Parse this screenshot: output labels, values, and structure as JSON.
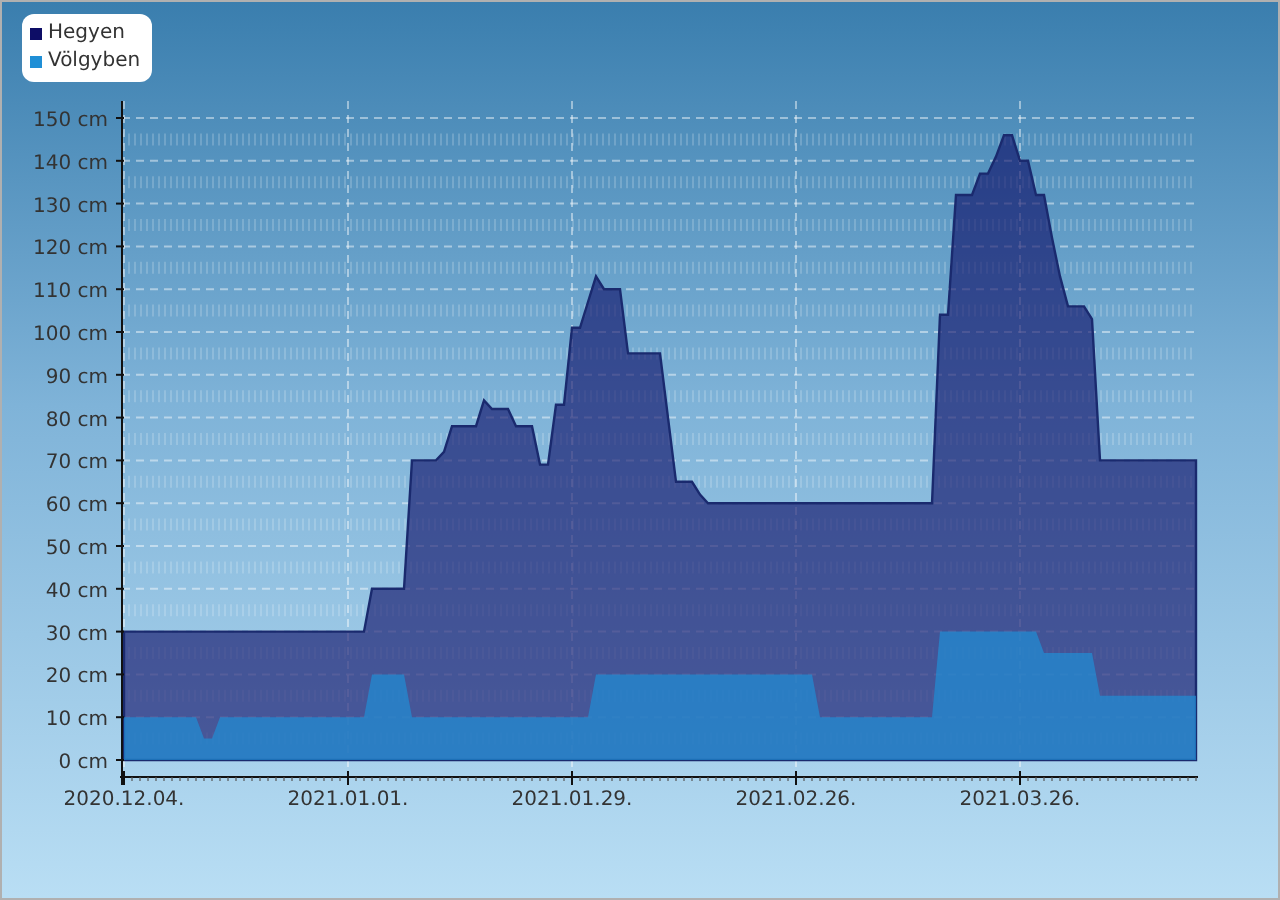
{
  "chart": {
    "chart_data": {
      "type": "area",
      "stacked": false,
      "grid": true,
      "legend": "top-left",
      "categories": [
        "2020.12.04.",
        null,
        null,
        null,
        null,
        null,
        null,
        null,
        null,
        null,
        null,
        null,
        null,
        null,
        null,
        null,
        null,
        null,
        null,
        null,
        null,
        null,
        null,
        null,
        null,
        null,
        null,
        null,
        "2021.01.01.",
        null,
        null,
        null,
        null,
        null,
        null,
        null,
        null,
        null,
        null,
        null,
        null,
        null,
        null,
        null,
        null,
        null,
        null,
        null,
        null,
        null,
        null,
        null,
        null,
        null,
        null,
        null,
        "2021.01.29.",
        null,
        null,
        null,
        null,
        null,
        null,
        null,
        null,
        null,
        null,
        null,
        null,
        null,
        null,
        null,
        null,
        null,
        null,
        null,
        null,
        null,
        null,
        null,
        null,
        null,
        null,
        null,
        "2021.02.26.",
        null,
        null,
        null,
        null,
        null,
        null,
        null,
        null,
        null,
        null,
        null,
        null,
        null,
        null,
        null,
        null,
        null,
        null,
        null,
        null,
        null,
        null,
        null,
        null,
        null,
        null,
        null,
        "2021.03.26.",
        null,
        null,
        null,
        null,
        null,
        null,
        null,
        null,
        null,
        null,
        null,
        null,
        null,
        null,
        null,
        null,
        null,
        null,
        null,
        null,
        null,
        null
      ],
      "series": [
        {
          "name": "Hegyen",
          "color": "#0d0d66",
          "values": [
            30,
            30,
            30,
            30,
            30,
            30,
            30,
            30,
            30,
            30,
            30,
            30,
            30,
            30,
            30,
            30,
            30,
            30,
            30,
            30,
            30,
            30,
            30,
            30,
            30,
            30,
            30,
            30,
            30,
            30,
            30,
            40,
            40,
            40,
            40,
            40,
            70,
            70,
            70,
            70,
            72,
            78,
            78,
            78,
            78,
            84,
            82,
            82,
            82,
            78,
            78,
            78,
            69,
            69,
            83,
            83,
            101,
            101,
            107,
            113,
            110,
            110,
            110,
            95,
            95,
            95,
            95,
            95,
            80,
            65,
            65,
            65,
            62,
            60,
            60,
            60,
            60,
            60,
            60,
            60,
            60,
            60,
            60,
            60,
            60,
            60,
            60,
            60,
            60,
            60,
            60,
            60,
            60,
            60,
            60,
            60,
            60,
            60,
            60,
            60,
            60,
            60,
            104,
            104,
            132,
            132,
            132,
            137,
            137,
            141,
            146,
            146,
            140,
            140,
            132,
            132,
            122,
            113,
            106,
            106,
            106,
            103,
            70,
            70,
            70,
            70,
            70,
            70,
            70,
            70,
            70,
            70,
            70,
            70,
            70
          ]
        },
        {
          "name": "Völgyben",
          "color": "#1f8fd6",
          "values": [
            10,
            10,
            10,
            10,
            10,
            10,
            10,
            10,
            10,
            10,
            5,
            5,
            10,
            10,
            10,
            10,
            10,
            10,
            10,
            10,
            10,
            10,
            10,
            10,
            10,
            10,
            10,
            10,
            10,
            10,
            10,
            20,
            20,
            20,
            20,
            20,
            10,
            10,
            10,
            10,
            10,
            10,
            10,
            10,
            10,
            10,
            10,
            10,
            10,
            10,
            10,
            10,
            10,
            10,
            10,
            10,
            10,
            10,
            10,
            20,
            20,
            20,
            20,
            20,
            20,
            20,
            20,
            20,
            20,
            20,
            20,
            20,
            20,
            20,
            20,
            20,
            20,
            20,
            20,
            20,
            20,
            20,
            20,
            20,
            20,
            20,
            20,
            10,
            10,
            10,
            10,
            10,
            10,
            10,
            10,
            10,
            10,
            10,
            10,
            10,
            10,
            10,
            30,
            30,
            30,
            30,
            30,
            30,
            30,
            30,
            30,
            30,
            30,
            30,
            30,
            25,
            25,
            25,
            25,
            25,
            25,
            25,
            15,
            15,
            15,
            15,
            15,
            15,
            15,
            15,
            15,
            15,
            15,
            15,
            15
          ]
        }
      ],
      "ylim": [
        -4,
        154
      ],
      "yticks": [
        {
          "value": 0,
          "label": "0 cm"
        },
        {
          "value": 10,
          "label": "10 cm"
        },
        {
          "value": 20,
          "label": "20 cm"
        },
        {
          "value": 30,
          "label": "30 cm"
        },
        {
          "value": 40,
          "label": "40 cm"
        },
        {
          "value": 50,
          "label": "50 cm"
        },
        {
          "value": 60,
          "label": "60 cm"
        },
        {
          "value": 70,
          "label": "70 cm"
        },
        {
          "value": 80,
          "label": "80 cm"
        },
        {
          "value": 90,
          "label": "90 cm"
        },
        {
          "value": 100,
          "label": "100 cm"
        },
        {
          "value": 110,
          "label": "110 cm"
        },
        {
          "value": 120,
          "label": "120 cm"
        },
        {
          "value": 130,
          "label": "130 cm"
        },
        {
          "value": 140,
          "label": "140 cm"
        },
        {
          "value": 150,
          "label": "150 cm"
        }
      ]
    }
  }
}
